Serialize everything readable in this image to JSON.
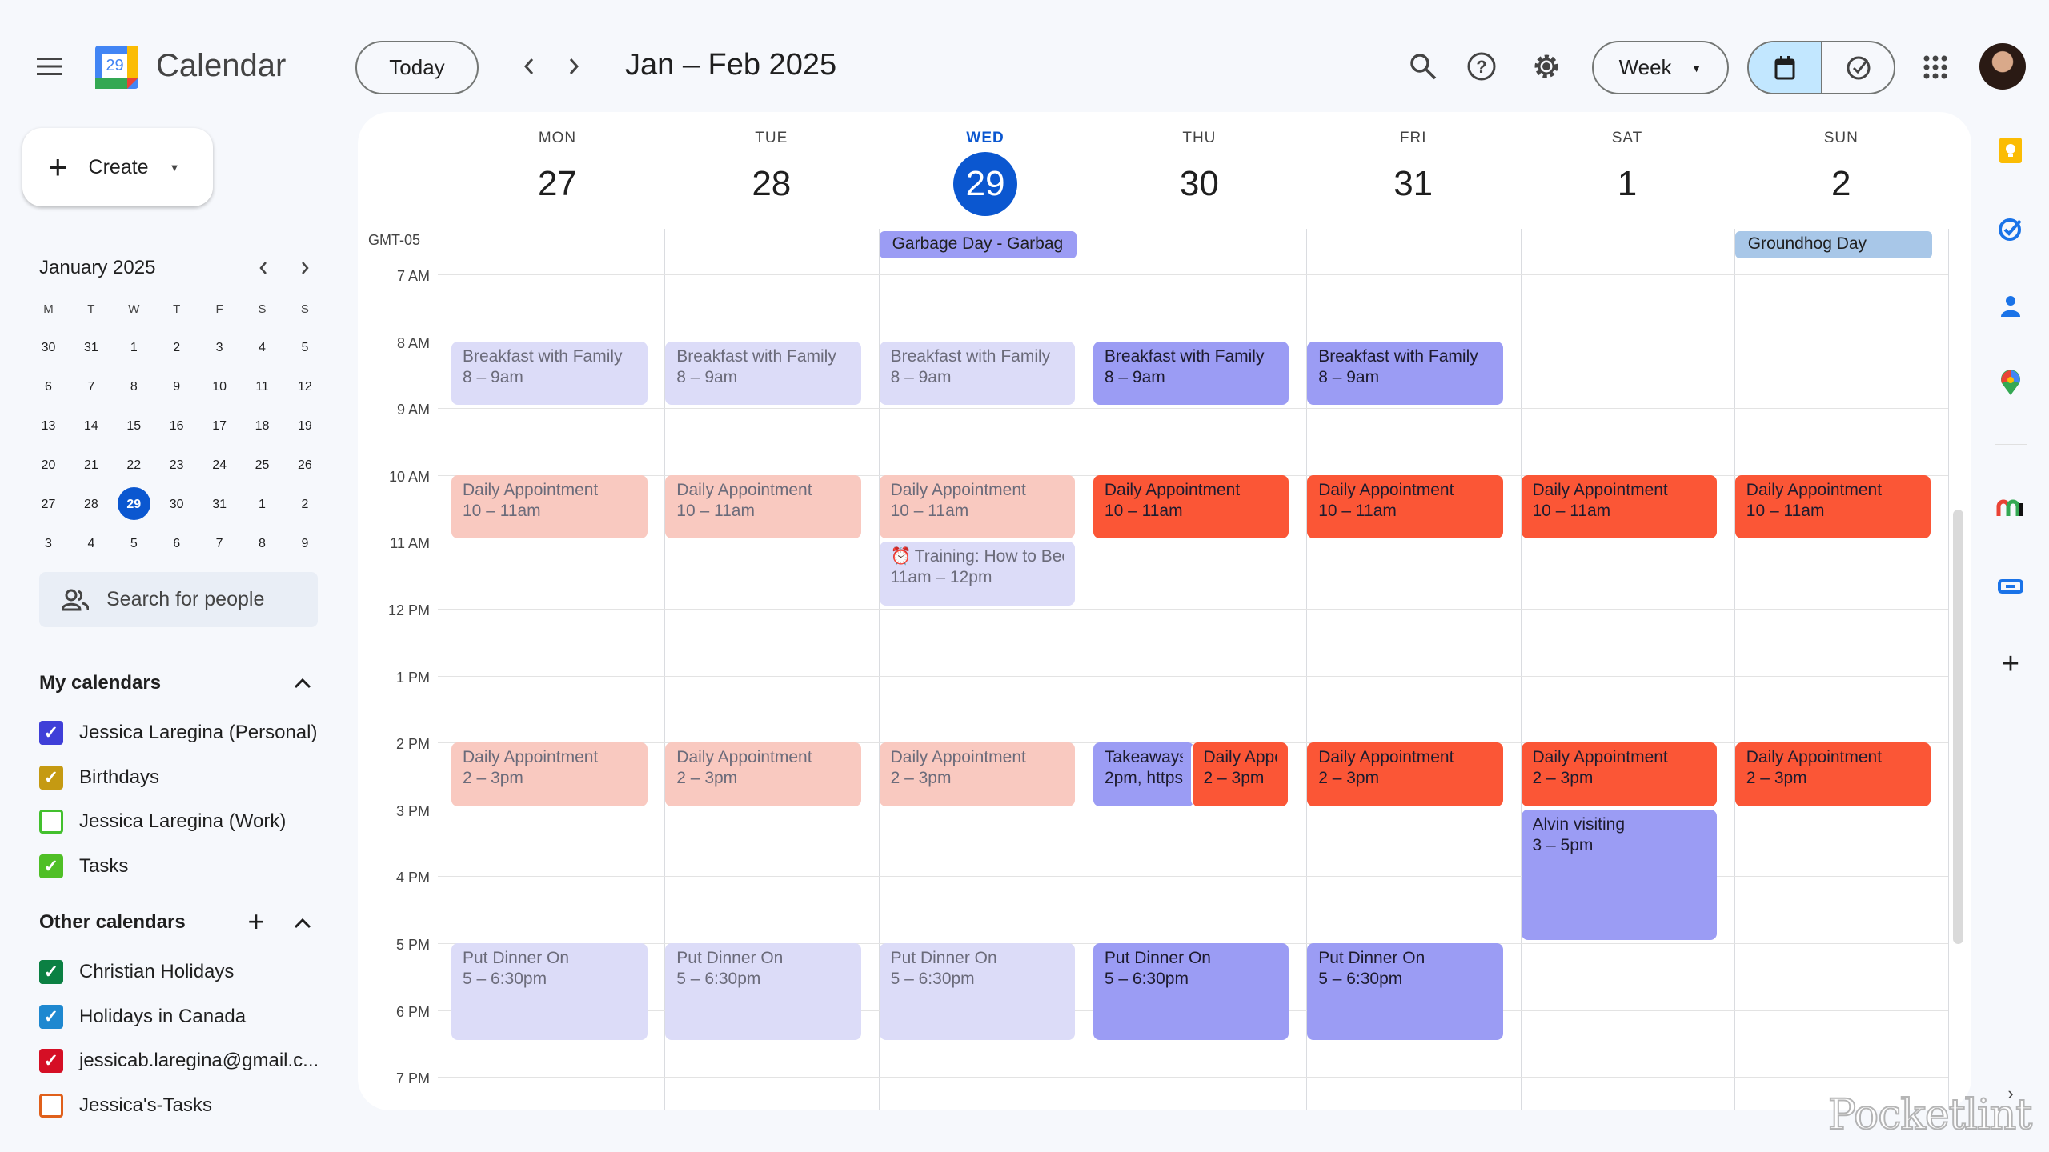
{
  "header": {
    "app_name": "Calendar",
    "logo_day": "29",
    "today_label": "Today",
    "date_range": "Jan – Feb 2025",
    "view_label": "Week"
  },
  "sidebar": {
    "create_label": "Create",
    "mini_calendar": {
      "title": "January 2025",
      "weekdays": [
        "M",
        "T",
        "W",
        "T",
        "F",
        "S",
        "S"
      ],
      "weeks": [
        [
          "30",
          "31",
          "1",
          "2",
          "3",
          "4",
          "5"
        ],
        [
          "6",
          "7",
          "8",
          "9",
          "10",
          "11",
          "12"
        ],
        [
          "13",
          "14",
          "15",
          "16",
          "17",
          "18",
          "19"
        ],
        [
          "20",
          "21",
          "22",
          "23",
          "24",
          "25",
          "26"
        ],
        [
          "27",
          "28",
          "29",
          "30",
          "31",
          "1",
          "2"
        ],
        [
          "3",
          "4",
          "5",
          "6",
          "7",
          "8",
          "9"
        ]
      ],
      "selected": "29"
    },
    "search_people_placeholder": "Search for people",
    "my_calendars": {
      "title": "My calendars",
      "items": [
        {
          "label": "Jessica Laregina (Personal)",
          "color": "#3f3fd8",
          "checked": true
        },
        {
          "label": "Birthdays",
          "color": "#c59a12",
          "checked": true
        },
        {
          "label": "Jessica Laregina (Work)",
          "color": "#43c02e",
          "checked": false
        },
        {
          "label": "Tasks",
          "color": "#4fbf26",
          "checked": true
        }
      ]
    },
    "other_calendars": {
      "title": "Other calendars",
      "items": [
        {
          "label": "Christian Holidays",
          "color": "#0b8043",
          "checked": true
        },
        {
          "label": "Holidays in Canada",
          "color": "#1e88d0",
          "checked": true
        },
        {
          "label": "jessicab.laregina@gmail.c...",
          "color": "#d50f25",
          "checked": true
        },
        {
          "label": "Jessica's-Tasks",
          "color": "#e0601b",
          "checked": false
        }
      ]
    }
  },
  "week": {
    "timezone": "GMT-05",
    "days": [
      {
        "dow": "MON",
        "date": "27"
      },
      {
        "dow": "TUE",
        "date": "28"
      },
      {
        "dow": "WED",
        "date": "29",
        "today": true
      },
      {
        "dow": "THU",
        "date": "30"
      },
      {
        "dow": "FRI",
        "date": "31"
      },
      {
        "dow": "SAT",
        "date": "1"
      },
      {
        "dow": "SUN",
        "date": "2"
      }
    ],
    "hours": [
      "7 AM",
      "8 AM",
      "9 AM",
      "10 AM",
      "11 AM",
      "12 PM",
      "1 PM",
      "2 PM",
      "3 PM",
      "4 PM",
      "5 PM",
      "6 PM",
      "7 PM"
    ],
    "all_day": [
      {
        "day": 2,
        "title": "Garbage Day - Garbag",
        "color": "#9b9cf4"
      },
      {
        "day": 6,
        "title": "Groundhog Day",
        "color": "#a8c7e8"
      }
    ],
    "events": [
      {
        "day": 0,
        "start": 8,
        "end": 9,
        "title": "Breakfast with Family",
        "time": "8 – 9am",
        "kind": "lavender",
        "past": true
      },
      {
        "day": 1,
        "start": 8,
        "end": 9,
        "title": "Breakfast with Family",
        "time": "8 – 9am",
        "kind": "lavender",
        "past": true
      },
      {
        "day": 2,
        "start": 8,
        "end": 9,
        "title": "Breakfast with Family",
        "time": "8 – 9am",
        "kind": "lavender",
        "past": true
      },
      {
        "day": 3,
        "start": 8,
        "end": 9,
        "title": "Breakfast with Family",
        "time": "8 – 9am",
        "kind": "lavender",
        "past": false
      },
      {
        "day": 4,
        "start": 8,
        "end": 9,
        "title": "Breakfast with Family",
        "time": "8 – 9am",
        "kind": "lavender",
        "past": false
      },
      {
        "day": 0,
        "start": 10,
        "end": 11,
        "title": "Daily Appointment",
        "time": "10 – 11am",
        "kind": "red",
        "past": true
      },
      {
        "day": 1,
        "start": 10,
        "end": 11,
        "title": "Daily Appointment",
        "time": "10 – 11am",
        "kind": "red",
        "past": true
      },
      {
        "day": 2,
        "start": 10,
        "end": 11,
        "title": "Daily Appointment",
        "time": "10 – 11am",
        "kind": "red",
        "past": true
      },
      {
        "day": 3,
        "start": 10,
        "end": 11,
        "title": "Daily Appointment",
        "time": "10 – 11am",
        "kind": "red",
        "past": false
      },
      {
        "day": 4,
        "start": 10,
        "end": 11,
        "title": "Daily Appointment",
        "time": "10 – 11am",
        "kind": "red",
        "past": false
      },
      {
        "day": 5,
        "start": 10,
        "end": 11,
        "title": "Daily Appointment",
        "time": "10 – 11am",
        "kind": "red",
        "past": false
      },
      {
        "day": 6,
        "start": 10,
        "end": 11,
        "title": "Daily Appointment",
        "time": "10 – 11am",
        "kind": "red",
        "past": false
      },
      {
        "day": 2,
        "start": 11,
        "end": 12,
        "title": "Training: How to Bec",
        "time": "11am – 12pm",
        "kind": "lavender",
        "past": true,
        "icon": "alarm-clock-icon"
      },
      {
        "day": 0,
        "start": 14,
        "end": 15,
        "title": "Daily Appointment",
        "time": "2 – 3pm",
        "kind": "red",
        "past": true
      },
      {
        "day": 1,
        "start": 14,
        "end": 15,
        "title": "Daily Appointment",
        "time": "2 – 3pm",
        "kind": "red",
        "past": true
      },
      {
        "day": 2,
        "start": 14,
        "end": 15,
        "title": "Daily Appointment",
        "time": "2 – 3pm",
        "kind": "red",
        "past": true
      },
      {
        "day": 3,
        "start": 14,
        "end": 15,
        "title": "Takeaways",
        "time": "2pm, https:",
        "kind": "lavender",
        "past": false,
        "slot": "left"
      },
      {
        "day": 3,
        "start": 14,
        "end": 15,
        "title": "Daily Appo",
        "time": "2 – 3pm",
        "kind": "red",
        "past": false,
        "slot": "right"
      },
      {
        "day": 4,
        "start": 14,
        "end": 15,
        "title": "Daily Appointment",
        "time": "2 – 3pm",
        "kind": "red",
        "past": false
      },
      {
        "day": 5,
        "start": 14,
        "end": 15,
        "title": "Daily Appointment",
        "time": "2 – 3pm",
        "kind": "red",
        "past": false
      },
      {
        "day": 6,
        "start": 14,
        "end": 15,
        "title": "Daily Appointment",
        "time": "2 – 3pm",
        "kind": "red",
        "past": false
      },
      {
        "day": 5,
        "start": 15,
        "end": 17,
        "title": "Alvin visiting",
        "time": "3 – 5pm",
        "kind": "lavender",
        "past": false
      },
      {
        "day": 0,
        "start": 17,
        "end": 18.5,
        "title": "Put Dinner On",
        "time": "5 – 6:30pm",
        "kind": "lavender",
        "past": true
      },
      {
        "day": 1,
        "start": 17,
        "end": 18.5,
        "title": "Put Dinner On",
        "time": "5 – 6:30pm",
        "kind": "lavender",
        "past": true
      },
      {
        "day": 2,
        "start": 17,
        "end": 18.5,
        "title": "Put Dinner On",
        "time": "5 – 6:30pm",
        "kind": "lavender",
        "past": true
      },
      {
        "day": 3,
        "start": 17,
        "end": 18.5,
        "title": "Put Dinner On",
        "time": "5 – 6:30pm",
        "kind": "lavender",
        "past": false
      },
      {
        "day": 4,
        "start": 17,
        "end": 18.5,
        "title": "Put Dinner On",
        "time": "5 – 6:30pm",
        "kind": "lavender",
        "past": false
      }
    ]
  },
  "colors": {
    "accent": "#0b57d0",
    "lavender": "#9b9cf4",
    "lavender_past": "#dcdcf8",
    "red": "#fb5636",
    "red_past": "#f9c9c0"
  },
  "side_rail": [
    "keep-icon",
    "tasks-icon",
    "contacts-icon",
    "maps-icon",
    "monday-icon",
    "link-addon-icon",
    "add-icon"
  ],
  "watermark": "Pocketlint"
}
